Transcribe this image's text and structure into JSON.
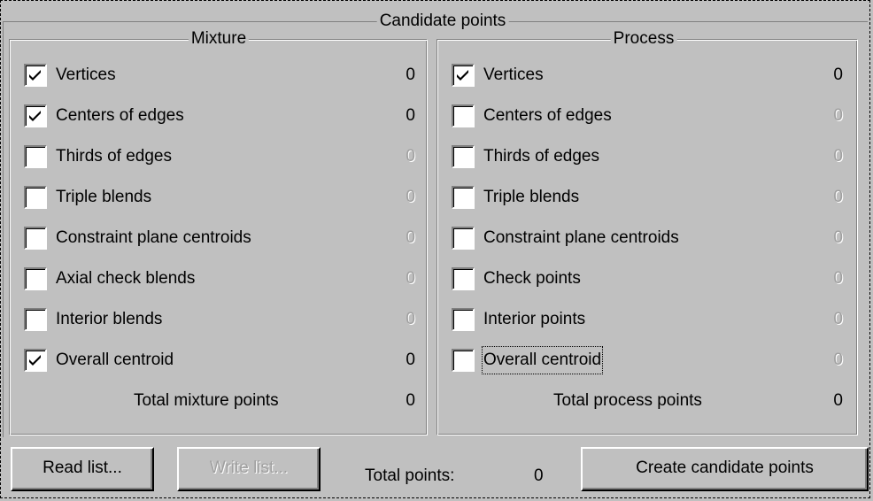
{
  "title": "Candidate points",
  "mixture": {
    "title": "Mixture",
    "items": [
      {
        "label": "Vertices",
        "checked": true,
        "count": "0",
        "enabled": true
      },
      {
        "label": "Centers of edges",
        "checked": true,
        "count": "0",
        "enabled": true
      },
      {
        "label": "Thirds of edges",
        "checked": false,
        "count": "0",
        "enabled": false
      },
      {
        "label": "Triple blends",
        "checked": false,
        "count": "0",
        "enabled": false
      },
      {
        "label": "Constraint plane centroids",
        "checked": false,
        "count": "0",
        "enabled": false
      },
      {
        "label": "Axial check blends",
        "checked": false,
        "count": "0",
        "enabled": false
      },
      {
        "label": "Interior blends",
        "checked": false,
        "count": "0",
        "enabled": false
      },
      {
        "label": "Overall centroid",
        "checked": true,
        "count": "0",
        "enabled": true
      }
    ],
    "total_label": "Total mixture points",
    "total": "0"
  },
  "process": {
    "title": "Process",
    "items": [
      {
        "label": "Vertices",
        "checked": true,
        "count": "0",
        "enabled": true
      },
      {
        "label": "Centers of edges",
        "checked": false,
        "count": "0",
        "enabled": false
      },
      {
        "label": "Thirds of edges",
        "checked": false,
        "count": "0",
        "enabled": false
      },
      {
        "label": "Triple blends",
        "checked": false,
        "count": "0",
        "enabled": false
      },
      {
        "label": "Constraint plane centroids",
        "checked": false,
        "count": "0",
        "enabled": false
      },
      {
        "label": "Check points",
        "checked": false,
        "count": "0",
        "enabled": false
      },
      {
        "label": "Interior points",
        "checked": false,
        "count": "0",
        "enabled": false
      },
      {
        "label": "Overall centroid",
        "checked": false,
        "count": "0",
        "enabled": false
      }
    ],
    "total_label": "Total process points",
    "total": "0"
  },
  "footer": {
    "read_list": "Read list...",
    "write_list": "Write list...",
    "total_points_label": "Total points:",
    "total_points": "0",
    "create": "Create candidate points"
  }
}
